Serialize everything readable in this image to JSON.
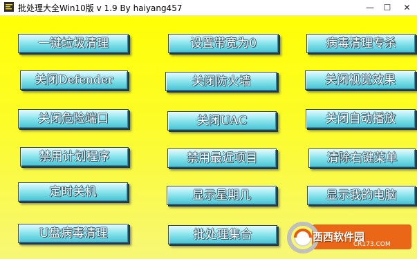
{
  "window": {
    "title": "批处理大全Win10版 v 1.9   By haiyang457",
    "minimize_glyph": "—",
    "maximize_glyph": "☐",
    "close_glyph": "✕"
  },
  "buttons": {
    "b1": "一键垃圾清理",
    "b2": "设置带宽为0",
    "b3": "病毒清理专杀",
    "b4": "关闭Defender",
    "b5": "关闭防火墙",
    "b6": "关闭视觉效果",
    "b7": "关闭危险端口",
    "b8": "关闭UAC",
    "b9": "关闭自动播放",
    "b10": "禁用计划程序",
    "b11": "禁用最近项目",
    "b12": "清除右键菜单",
    "b13": "定时关机",
    "b14": "显示星期几",
    "b15": "显示我的电脑",
    "b16": "U盘病毒清理",
    "b17": "批处理集合"
  },
  "watermark": {
    "brand": "西西软件园",
    "url": "CR173.COM"
  },
  "colors": {
    "background_top": "#ffff05",
    "background_bottom": "#f7f777",
    "button_face": "#8fe6ee",
    "button_text": "#ffffff"
  }
}
